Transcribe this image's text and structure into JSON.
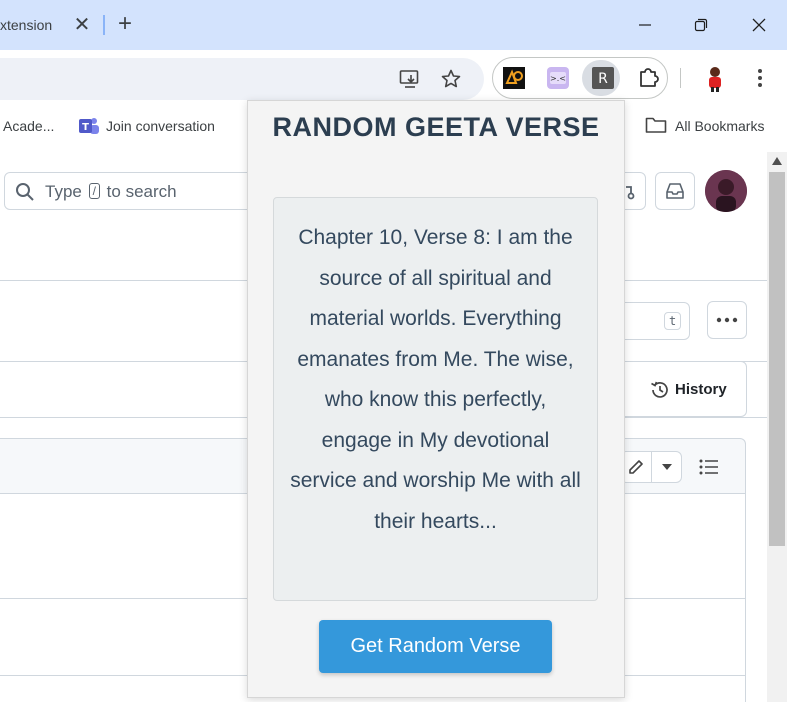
{
  "browser": {
    "tab": {
      "title": "xtension",
      "close": "✕"
    },
    "new_tab": "+",
    "window_controls": {
      "minimize": "minimize-icon",
      "restore": "restore-icon",
      "close": "close-icon"
    }
  },
  "toolbar": {
    "omnibox_icons": [
      "install-app-icon",
      "bookmark-star-icon"
    ],
    "extensions": [
      {
        "name": "music-extension-icon"
      },
      {
        "name": "face-extension-icon"
      },
      {
        "name": "random-geeta-extension-icon",
        "letter": "R"
      },
      {
        "name": "puzzle-extensions-icon"
      }
    ]
  },
  "bookmarks": {
    "items": [
      {
        "label": "Acade..."
      },
      {
        "label": "Join conversation"
      },
      {
        "label": "All Bookmarks"
      }
    ]
  },
  "github": {
    "search": {
      "prefix": "Type",
      "key": "/",
      "suffix": "to search"
    },
    "history_label": "History",
    "kbd_t": "t"
  },
  "popup": {
    "title": "RANDOM GEETA VERSE",
    "verse": "Chapter 10, Verse 8: I am the source of all spiritual and material worlds. Everything emanates from Me. The wise, who know this perfectly, engage in My devotional service and worship Me with all their hearts...",
    "button": "Get Random Verse",
    "colors": {
      "title": "#2c3e50",
      "button_bg": "#3498db",
      "button_text": "#ffffff"
    }
  }
}
